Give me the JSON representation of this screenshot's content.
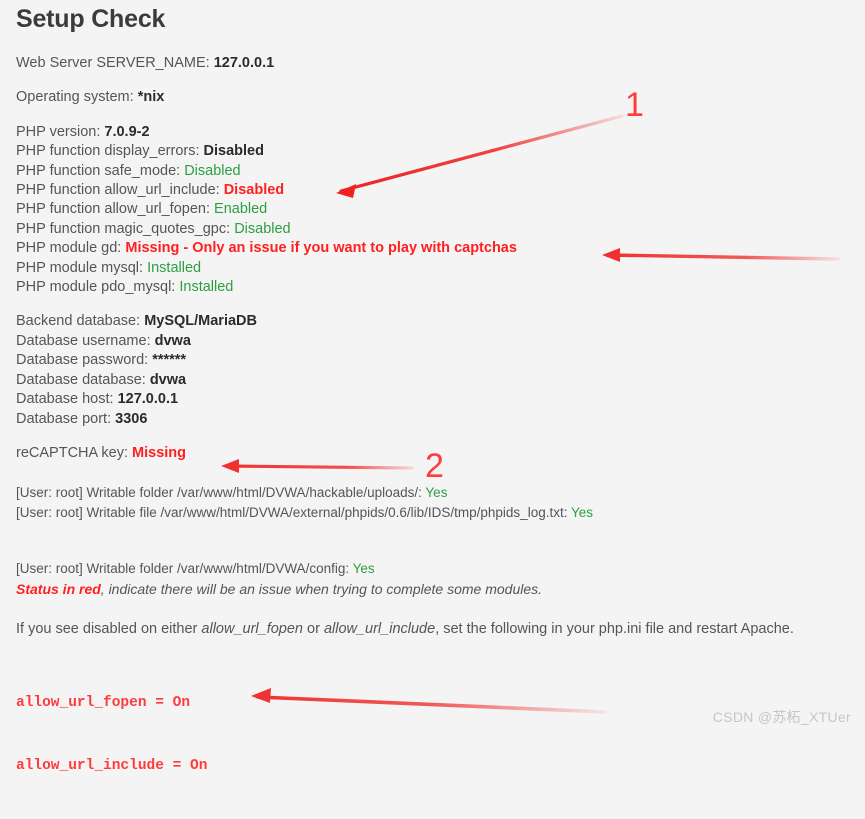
{
  "page": {
    "title": "Setup Check",
    "background_color": "#f4f4f4",
    "text_color": "#555555",
    "ok_color": "#2f9e41",
    "error_color": "#ff2020",
    "annotation_color": "#ff3b3b"
  },
  "server": {
    "server_name_label": "Web Server SERVER_NAME:",
    "server_name_value": "127.0.0.1",
    "os_label": "Operating system:",
    "os_value": "*nix"
  },
  "php": {
    "version_label": "PHP version:",
    "version_value": "7.0.9-2",
    "display_errors_label": "PHP function display_errors:",
    "display_errors_value": "Disabled",
    "safe_mode_label": "PHP function safe_mode:",
    "safe_mode_value": "Disabled",
    "allow_url_include_label": "PHP function allow_url_include:",
    "allow_url_include_value": "Disabled",
    "allow_url_fopen_label": "PHP function allow_url_fopen:",
    "allow_url_fopen_value": "Enabled",
    "magic_quotes_label": "PHP function magic_quotes_gpc:",
    "magic_quotes_value": "Disabled",
    "module_gd_label": "PHP module gd:",
    "module_gd_value": "Missing - Only an issue if you want to play with captchas",
    "module_mysql_label": "PHP module mysql:",
    "module_mysql_value": "Installed",
    "module_pdo_mysql_label": "PHP module pdo_mysql:",
    "module_pdo_mysql_value": "Installed"
  },
  "database": {
    "backend_label": "Backend database:",
    "backend_value": "MySQL/MariaDB",
    "username_label": "Database username:",
    "username_value": "dvwa",
    "password_label": "Database password:",
    "password_value": "******",
    "database_label": "Database database:",
    "database_value": "dvwa",
    "host_label": "Database host:",
    "host_value": "127.0.0.1",
    "port_label": "Database port:",
    "port_value": "3306"
  },
  "recaptcha": {
    "label": "reCAPTCHA key:",
    "value": "Missing"
  },
  "permissions": {
    "uploads_label": "[User: root] Writable folder /var/www/html/DVWA/hackable/uploads/:",
    "uploads_value": "Yes",
    "phpids_label": "[User: root] Writable file /var/www/html/DVWA/external/phpids/0.6/lib/IDS/tmp/phpids_log.txt:",
    "phpids_value": "Yes",
    "config_label": "[User: root] Writable folder /var/www/html/DVWA/config:",
    "config_value": "Yes"
  },
  "notes": {
    "status_red_strong": "Status in red",
    "status_red_rest": ", indicate there will be an issue when trying to complete some modules.",
    "instruction_part1": "If you see disabled on either ",
    "instruction_em1": "allow_url_fopen",
    "instruction_part2": " or ",
    "instruction_em2": "allow_url_include",
    "instruction_part3": ", set the following in your php.ini file and restart Apache."
  },
  "code": {
    "line1": "allow_url_fopen = On",
    "line2": "allow_url_include = On"
  },
  "annotations": {
    "marker_one": "1",
    "marker_two": "2"
  },
  "watermark": {
    "text": "CSDN @苏柘_XTUer"
  }
}
